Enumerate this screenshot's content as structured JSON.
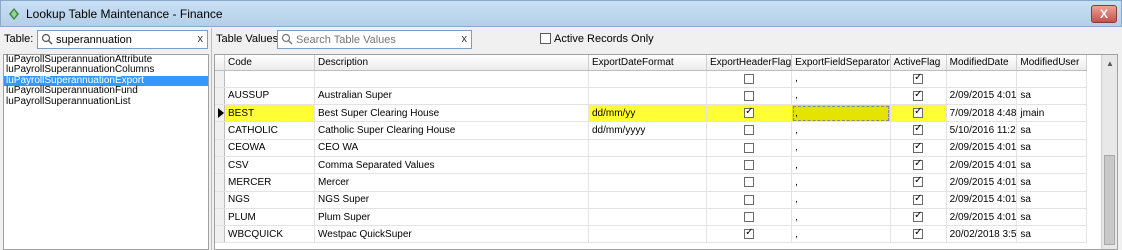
{
  "window": {
    "title": "Lookup Table Maintenance - Finance",
    "close_glyph": "X"
  },
  "table_filter": {
    "label": "Table:",
    "value": "superannuation",
    "clear_glyph": "x"
  },
  "tables": [
    "luPayrollSuperannuationAttribute",
    "luPayrollSuperannuationColumns",
    "luPayrollSuperannuationExport",
    "luPayrollSuperannuationFund",
    "luPayrollSuperannuationList"
  ],
  "selected_table_index": 2,
  "values_filter": {
    "label": "Table Values:",
    "placeholder": "Search Table Values",
    "clear_glyph": "x"
  },
  "active_only": {
    "label": "Active Records Only",
    "checked": false
  },
  "grid": {
    "columns": [
      "Code",
      "Description",
      "ExportDateFormat",
      "ExportHeaderFlag",
      "ExportFieldSeparator",
      "ActiveFlag",
      "ModifiedDate",
      "ModifiedUser"
    ],
    "rows": [
      {
        "code": "",
        "description": "",
        "date_format": "",
        "header_flag": false,
        "separator": ",",
        "active": true,
        "modified_date": "",
        "modified_user": "",
        "current": false,
        "highlight": false
      },
      {
        "code": "AUSSUP",
        "description": "Australian Super",
        "date_format": "",
        "header_flag": false,
        "separator": ",",
        "active": true,
        "modified_date": "2/09/2015 4:01",
        "modified_user": "sa",
        "current": false,
        "highlight": false
      },
      {
        "code": "BEST",
        "description": "Best Super Clearing House",
        "date_format": "dd/mm/yy",
        "header_flag": true,
        "separator": ",",
        "active": true,
        "modified_date": "7/09/2018 4:48",
        "modified_user": "jmain",
        "current": true,
        "highlight": true
      },
      {
        "code": "CATHOLIC",
        "description": "Catholic Super Clearing House",
        "date_format": "dd/mm/yyyy",
        "header_flag": false,
        "separator": ",",
        "active": true,
        "modified_date": "5/10/2016 11:2",
        "modified_user": "sa",
        "current": false,
        "highlight": false
      },
      {
        "code": "CEOWA",
        "description": "CEO WA",
        "date_format": "",
        "header_flag": false,
        "separator": ",",
        "active": true,
        "modified_date": "2/09/2015 4:01",
        "modified_user": "sa",
        "current": false,
        "highlight": false
      },
      {
        "code": "CSV",
        "description": "Comma Separated Values",
        "date_format": "",
        "header_flag": false,
        "separator": ",",
        "active": true,
        "modified_date": "2/09/2015 4:01",
        "modified_user": "sa",
        "current": false,
        "highlight": false
      },
      {
        "code": "MERCER",
        "description": "Mercer",
        "date_format": "",
        "header_flag": false,
        "separator": ",",
        "active": true,
        "modified_date": "2/09/2015 4:01",
        "modified_user": "sa",
        "current": false,
        "highlight": false
      },
      {
        "code": "NGS",
        "description": "NGS Super",
        "date_format": "",
        "header_flag": false,
        "separator": ",",
        "active": true,
        "modified_date": "2/09/2015 4:01",
        "modified_user": "sa",
        "current": false,
        "highlight": false
      },
      {
        "code": "PLUM",
        "description": "Plum Super",
        "date_format": "",
        "header_flag": false,
        "separator": ",",
        "active": true,
        "modified_date": "2/09/2015 4:01",
        "modified_user": "sa",
        "current": false,
        "highlight": false
      },
      {
        "code": "WBCQUICK",
        "description": "Westpac QuickSuper",
        "date_format": "",
        "header_flag": true,
        "separator": ",",
        "active": true,
        "modified_date": "20/02/2018 3:5",
        "modified_user": "sa",
        "current": false,
        "highlight": false
      }
    ]
  },
  "colors": {
    "highlight": "#ffff33",
    "selection": "#3399ff"
  }
}
